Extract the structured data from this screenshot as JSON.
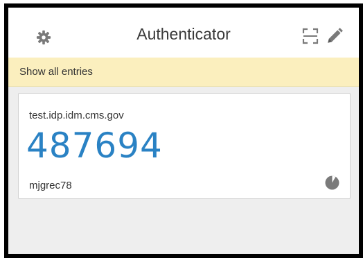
{
  "app": {
    "title": "Authenticator"
  },
  "header": {
    "settings_icon": "gear-icon",
    "scan_icon": "scan-qr-icon",
    "edit_icon": "pencil-icon"
  },
  "notice": {
    "label": "Show all entries"
  },
  "entries": [
    {
      "issuer": "test.idp.idm.cms.gov",
      "code": "487694",
      "account": "mjgrec78",
      "timer_icon": "countdown-pie-icon"
    }
  ],
  "colors": {
    "code": "#2a82c4",
    "notice_background": "#fbefbe",
    "icon": "#7a7a7a"
  }
}
